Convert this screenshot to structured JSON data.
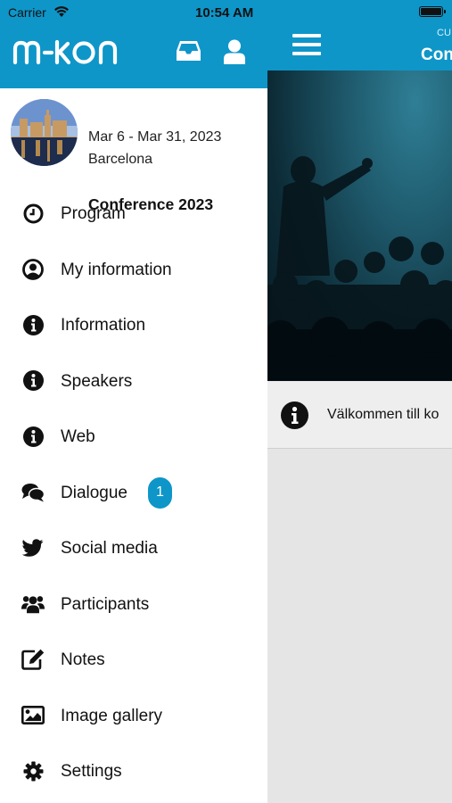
{
  "status_bar": {
    "carrier": "Carrier",
    "time": "10:54 AM"
  },
  "app": {
    "logo_text": "m-kon"
  },
  "event": {
    "title": "Conference 2023",
    "dates": "Mar 6 - Mar 31, 2023",
    "location": "Barcelona"
  },
  "menu": [
    {
      "label": "Program",
      "icon": "clock-icon"
    },
    {
      "label": "My information",
      "icon": "user-circle-icon"
    },
    {
      "label": "Information",
      "icon": "info-icon"
    },
    {
      "label": "Speakers",
      "icon": "info-icon"
    },
    {
      "label": "Web",
      "icon": "info-icon"
    },
    {
      "label": "Dialogue",
      "icon": "chat-bubbles-icon",
      "badge": "1"
    },
    {
      "label": "Social media",
      "icon": "twitter-bird-icon"
    },
    {
      "label": "Participants",
      "icon": "group-icon"
    },
    {
      "label": "Notes",
      "icon": "edit-note-icon"
    },
    {
      "label": "Image gallery",
      "icon": "image-icon"
    },
    {
      "label": "Settings",
      "icon": "gear-icon"
    }
  ],
  "main": {
    "header_subtitle": "CU",
    "header_title": "Con",
    "welcome_text": "Välkommen till ko"
  },
  "colors": {
    "brand": "#0e96c9",
    "badge": "#0e96c9"
  }
}
